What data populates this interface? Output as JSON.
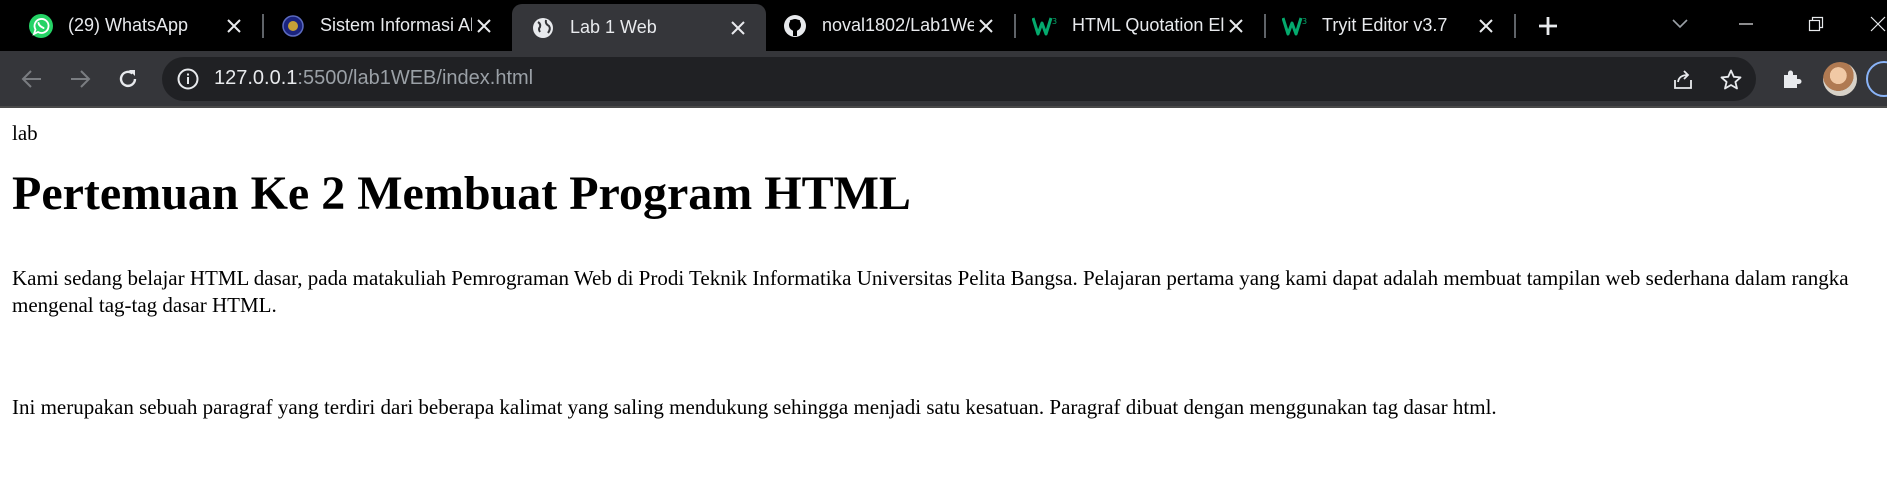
{
  "tabs": [
    {
      "title": "(29) WhatsApp",
      "icon": "whatsapp-icon",
      "active": false
    },
    {
      "title": "Sistem Informasi Al",
      "icon": "university-seal-icon",
      "active": false
    },
    {
      "title": "Lab 1 Web",
      "icon": "globe-icon",
      "active": true
    },
    {
      "title": "noval1802/Lab1We",
      "icon": "github-icon",
      "active": false
    },
    {
      "title": "HTML Quotation El",
      "icon": "w3schools-icon",
      "active": false
    },
    {
      "title": "Tryit Editor v3.7",
      "icon": "w3schools-icon",
      "active": false
    }
  ],
  "address_bar": {
    "host": "127.0.0.1",
    "path": ":5500/lab1WEB/index.html"
  },
  "page": {
    "small_heading": "lab",
    "heading": "Pertemuan Ke 2 Membuat Program HTML",
    "paragraph1": "Kami sedang belajar HTML dasar, pada matakuliah Pemrograman Web di Prodi Teknik Informatika Universitas Pelita Bangsa. Pelajaran pertama yang kami dapat adalah membuat tampilan web sederhana dalam rangka mengenal tag-tag dasar HTML.",
    "paragraph2": "Ini merupakan sebuah paragraf yang terdiri dari beberapa kalimat yang saling mendukung sehingga menjadi satu kesatuan. Paragraf dibuat dengan menggunakan tag dasar html."
  },
  "colors": {
    "whatsapp": "#25d366",
    "w3schools": "#04aa6d",
    "tabstrip_bg": "#000000",
    "toolbar_bg": "#35363a",
    "omnibox_bg": "#202124"
  }
}
